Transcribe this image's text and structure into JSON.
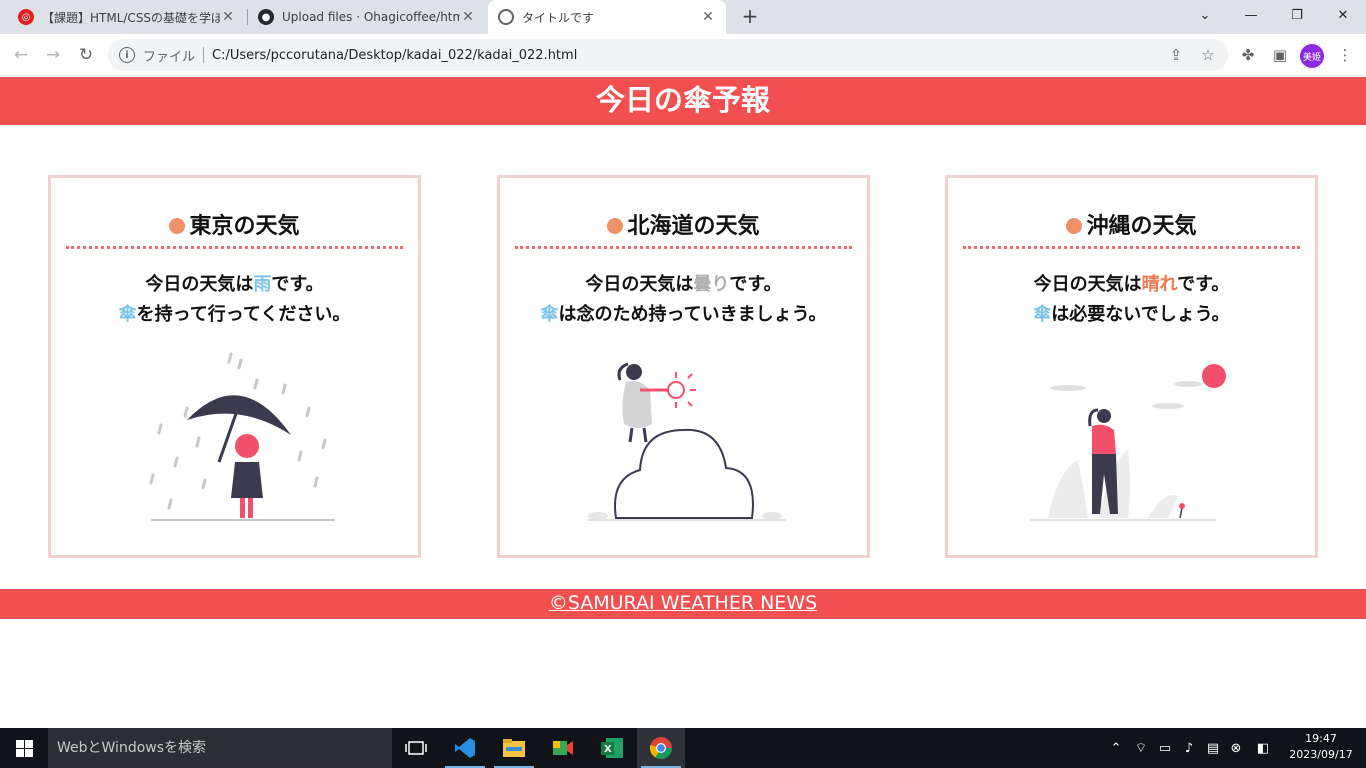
{
  "browser": {
    "tabs": [
      {
        "title": "【課題】HTML/CSSの基礎を学ぼう -",
        "close": "✕"
      },
      {
        "title": "Upload files · Ohagicoffee/html-c",
        "close": "✕"
      },
      {
        "title": "タイトルです",
        "close": "✕"
      }
    ],
    "new_tab": "+",
    "window_controls": {
      "dropdown": "⌄",
      "minimize": "—",
      "restore": "❐",
      "close": "✕"
    },
    "address": {
      "scheme_label": "ファイル",
      "url": "C:/Users/pccorutana/Desktop/kadai_022/kadai_022.html"
    },
    "profile_initials": "美姫"
  },
  "page": {
    "header_title": "今日の傘予報",
    "cards": [
      {
        "title": "東京の天気",
        "line1_pre": "今日の天気は",
        "line1_weather": "雨",
        "line1_post": "です。",
        "line2_umbrella": "傘",
        "line2_post": "を持って行ってください。",
        "weather_color": "#7cc4e8"
      },
      {
        "title": "北海道の天気",
        "line1_pre": "今日の天気は",
        "line1_weather": "曇り",
        "line1_post": "です。",
        "line2_umbrella": "傘",
        "line2_post": "は念のため持っていきましょう。",
        "weather_color": "#b0b0b0"
      },
      {
        "title": "沖縄の天気",
        "line1_pre": "今日の天気は",
        "line1_weather": "晴れ",
        "line1_post": "です。",
        "line2_umbrella": "傘",
        "line2_post": "は必要ないでしょう。",
        "weather_color": "#f07a50"
      }
    ],
    "footer_text": "©SAMURAI WEATHER NEWS",
    "colors": {
      "brand_red": "#f25050",
      "card_border": "#f0d0d0",
      "title_dot": "#f0906a",
      "umbrella_blue": "#7cc4e8"
    }
  },
  "taskbar": {
    "search_placeholder": "WebとWindowsを検索",
    "apps": [
      "task-view-icon",
      "vscode-icon",
      "file-explorer-icon",
      "meet-icon",
      "excel-icon",
      "chrome-icon"
    ],
    "clock_time": "19:47",
    "clock_date": "2023/09/17"
  }
}
